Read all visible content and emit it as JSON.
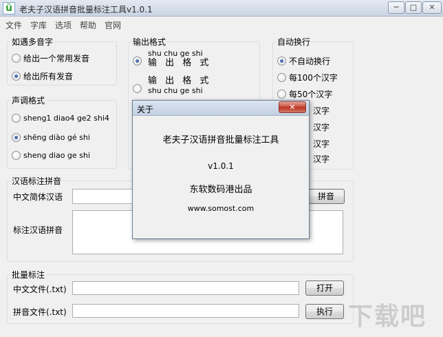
{
  "window": {
    "title": "老夫子汉语拼音批量标注工具v1.0.1",
    "icon_letter": "ü",
    "min_glyph": "─",
    "max_glyph": "□",
    "close_glyph": "✕"
  },
  "menu": [
    "文件",
    "字库",
    "选项",
    "帮助",
    "官网"
  ],
  "polyphone": {
    "label": "如遇多音字",
    "options": [
      {
        "label": "给出一个常用发音",
        "checked": false
      },
      {
        "label": "给出所有发音",
        "checked": true
      }
    ]
  },
  "tone": {
    "label": "声调格式",
    "options": [
      {
        "label": "sheng1 diao4 ge2 shi4",
        "checked": false
      },
      {
        "label": "shēng diào gé shi",
        "checked": true
      },
      {
        "label": "sheng diao ge shi",
        "checked": false
      }
    ]
  },
  "output": {
    "label": "输出格式",
    "options": [
      {
        "line1": "shu chu ge shi",
        "line2": "输 出 格 式",
        "checked": true
      },
      {
        "line1": "输 出 格 式",
        "line2": "shu chu ge shi",
        "checked": false
      }
    ]
  },
  "autowrap": {
    "label": "自动换行",
    "options": [
      {
        "label": "不自动换行",
        "checked": true
      },
      {
        "label": "每100个汉字",
        "checked": false
      },
      {
        "label": "每50个汉字",
        "checked": false
      },
      {
        "label": "汉字",
        "checked": false
      },
      {
        "label": "汉字",
        "checked": false
      },
      {
        "label": "汉字",
        "checked": false
      },
      {
        "label": "汉字",
        "checked": false
      }
    ]
  },
  "annotate": {
    "label": "汉语标注拼音",
    "input_label": "中文简体汉语",
    "input_value": "",
    "button": "拼音",
    "output_label": "标注汉语拼音",
    "output_value": ""
  },
  "batch": {
    "label": "批量标注",
    "cn_file_label": "中文文件(.txt)",
    "cn_file_value": "",
    "open_button": "打开",
    "py_file_label": "拼音文件(.txt)",
    "py_file_value": "",
    "run_button": "执行"
  },
  "about": {
    "title": "关于",
    "close": "✕",
    "app_name": "老夫子汉语拼音批量标注工具",
    "version": "v1.0.1",
    "publisher": "东软数码港出品",
    "website": "www.somost.com"
  },
  "watermark": "下载吧"
}
